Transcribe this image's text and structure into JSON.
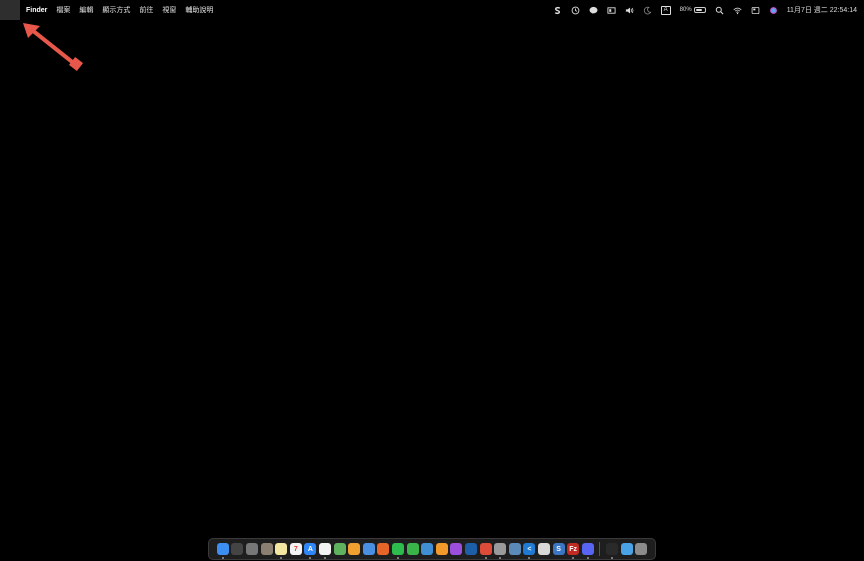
{
  "menubar": {
    "app_name": "Finder",
    "menus": [
      "檔案",
      "編輯",
      "顯示方式",
      "前往",
      "視窗",
      "輔助說明"
    ],
    "status": {
      "battery_percent": "80%",
      "input_source": "A",
      "datetime": "11月7日 週二  22:54:14"
    }
  },
  "annotation": {
    "arrow_color": "#e8584a"
  },
  "dock": {
    "apps": [
      {
        "name": "finder-icon",
        "color": "#3c8ef0",
        "running": true
      },
      {
        "name": "mission-control-icon",
        "color": "#444444",
        "running": false
      },
      {
        "name": "launchpad-icon",
        "color": "#777777",
        "running": false
      },
      {
        "name": "photos-grid-icon",
        "color": "#8a7f70",
        "running": false
      },
      {
        "name": "notes-icon",
        "color": "#f2e6a0",
        "running": true
      },
      {
        "name": "calendar-icon",
        "color": "#f4f4f4",
        "glyph": "7",
        "glyph_color": "#e0443c",
        "running": false
      },
      {
        "name": "app-store-icon",
        "color": "#2f86f6",
        "glyph": "A",
        "running": true
      },
      {
        "name": "reminders-icon",
        "color": "#f4f4f4",
        "running": true
      },
      {
        "name": "maps-icon",
        "color": "#5fb35f",
        "running": false
      },
      {
        "name": "photos-icon",
        "color": "#f0a030",
        "running": false
      },
      {
        "name": "chrome-profile-icon",
        "color": "#4a90e2",
        "running": false
      },
      {
        "name": "firefox-icon",
        "color": "#e8652a",
        "running": false
      },
      {
        "name": "line-icon",
        "color": "#2dbc4e",
        "running": true
      },
      {
        "name": "numbers-icon",
        "color": "#39b54a",
        "running": false
      },
      {
        "name": "keynote-icon",
        "color": "#3f8fd2",
        "running": false
      },
      {
        "name": "pages-icon",
        "color": "#f19a2b",
        "running": false
      },
      {
        "name": "podcasts-icon",
        "color": "#9b4fdc",
        "running": false
      },
      {
        "name": "xcode-icon",
        "color": "#1c5ea8",
        "running": false
      },
      {
        "name": "chrome-icon",
        "color": "#dd4b39",
        "running": true
      },
      {
        "name": "settings-icon",
        "color": "#9a9a9a",
        "running": true
      },
      {
        "name": "preview-icon",
        "color": "#5b8ab8",
        "running": false
      },
      {
        "name": "vscode-icon",
        "color": "#1f7ad4",
        "glyph": "<",
        "running": true
      },
      {
        "name": "github-icon",
        "color": "#d8d8d8",
        "running": false
      },
      {
        "name": "scrivener-icon",
        "color": "#3a76c4",
        "glyph": "S",
        "running": false
      },
      {
        "name": "filezilla-icon",
        "color": "#bf2a22",
        "glyph": "Fz",
        "running": true
      },
      {
        "name": "discord-icon",
        "color": "#5865f2",
        "running": true
      }
    ],
    "extras": [
      {
        "name": "terminal-icon",
        "color": "#2a2a2a",
        "running": true
      },
      {
        "name": "downloads-folder-icon",
        "color": "#4aa3e6",
        "running": false
      },
      {
        "name": "trash-icon",
        "color": "#8c8c8c",
        "running": false
      }
    ]
  }
}
